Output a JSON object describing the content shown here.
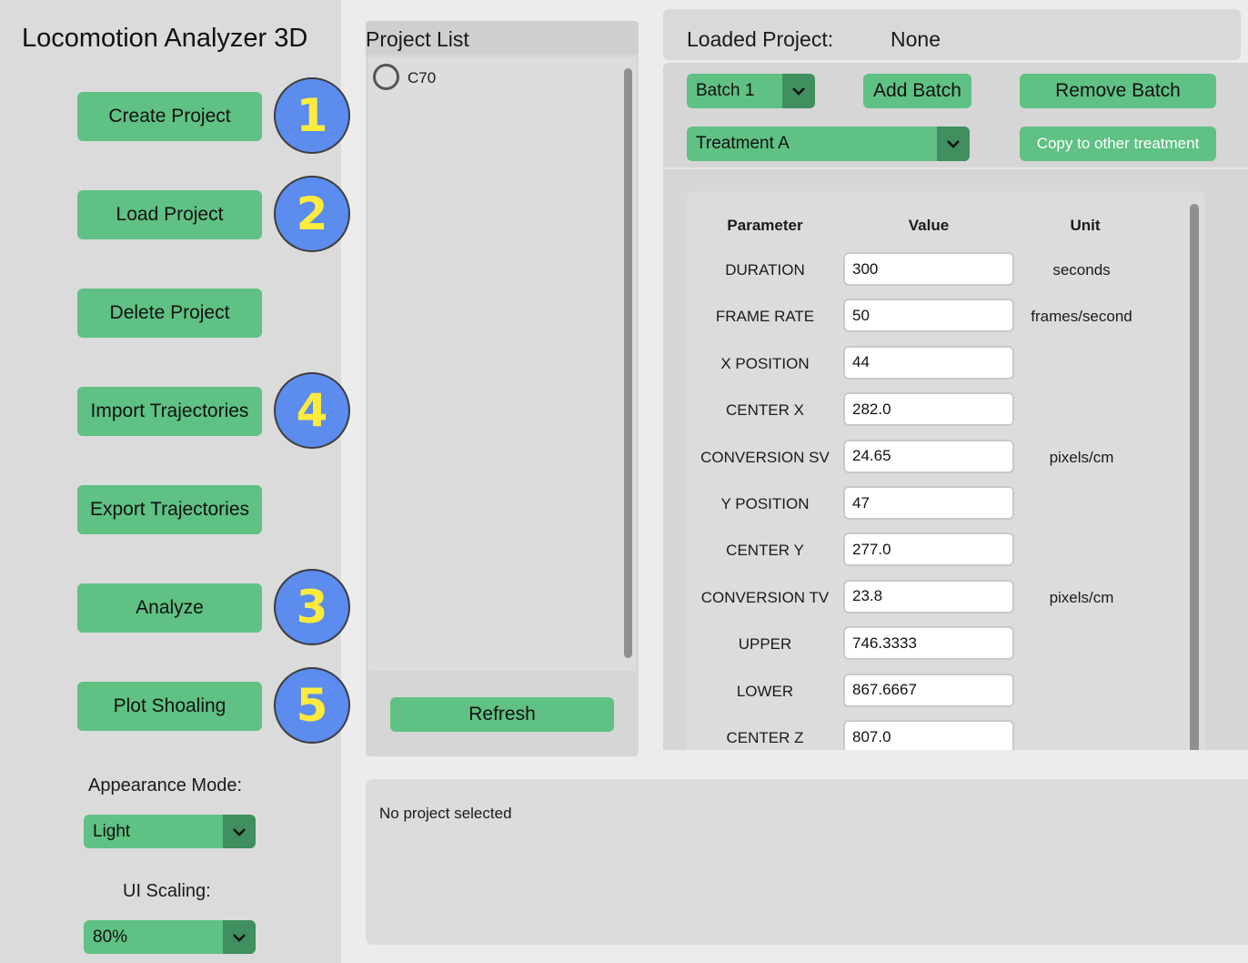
{
  "app": {
    "title": "Locomotion Analyzer 3D"
  },
  "sidebar": {
    "buttons": [
      {
        "label": "Create Project",
        "badge": "1"
      },
      {
        "label": "Load Project",
        "badge": "2"
      },
      {
        "label": "Delete Project",
        "badge": ""
      },
      {
        "label": "Import Trajectories",
        "badge": "4"
      },
      {
        "label": "Export Trajectories",
        "badge": ""
      },
      {
        "label": "Analyze",
        "badge": "3"
      },
      {
        "label": "Plot Shoaling",
        "badge": "5"
      }
    ],
    "appearance_label": "Appearance Mode:",
    "appearance_value": "Light",
    "scaling_label": "UI Scaling:",
    "scaling_value": "80%"
  },
  "project_list": {
    "title": "Project List",
    "items": [
      {
        "name": "C70",
        "selected": false
      }
    ],
    "refresh_label": "Refresh"
  },
  "loaded_project": {
    "label": "Loaded Project:",
    "value": "None"
  },
  "batch": {
    "selected": "Batch 1",
    "add_label": "Add Batch",
    "remove_label": "Remove Batch"
  },
  "treatment": {
    "selected": "Treatment A",
    "copy_label": "Copy to other treatment"
  },
  "params": {
    "headers": {
      "parameter": "Parameter",
      "value": "Value",
      "unit": "Unit"
    },
    "rows": [
      {
        "name": "DURATION",
        "value": "300",
        "unit": "seconds"
      },
      {
        "name": "FRAME RATE",
        "value": "50",
        "unit": "frames/second"
      },
      {
        "name": "X POSITION",
        "value": "44",
        "unit": ""
      },
      {
        "name": "CENTER X",
        "value": "282.0",
        "unit": ""
      },
      {
        "name": "CONVERSION SV",
        "value": "24.65",
        "unit": "pixels/cm"
      },
      {
        "name": "Y POSITION",
        "value": "47",
        "unit": ""
      },
      {
        "name": "CENTER Y",
        "value": "277.0",
        "unit": ""
      },
      {
        "name": "CONVERSION TV",
        "value": "23.8",
        "unit": "pixels/cm"
      },
      {
        "name": "UPPER",
        "value": "746.3333",
        "unit": ""
      },
      {
        "name": "LOWER",
        "value": "867.6667",
        "unit": ""
      },
      {
        "name": "CENTER Z",
        "value": "807.0",
        "unit": ""
      }
    ]
  },
  "status": {
    "text": "No project selected"
  },
  "colors": {
    "button": "#5fc183",
    "dropdown_arrow": "#3f8f5f",
    "badge_fill": "#5b8cee",
    "badge_text": "#ffeb3b"
  },
  "icons": {
    "dropdown": "chevron-down-icon",
    "radio": "radio-unselected-icon"
  }
}
